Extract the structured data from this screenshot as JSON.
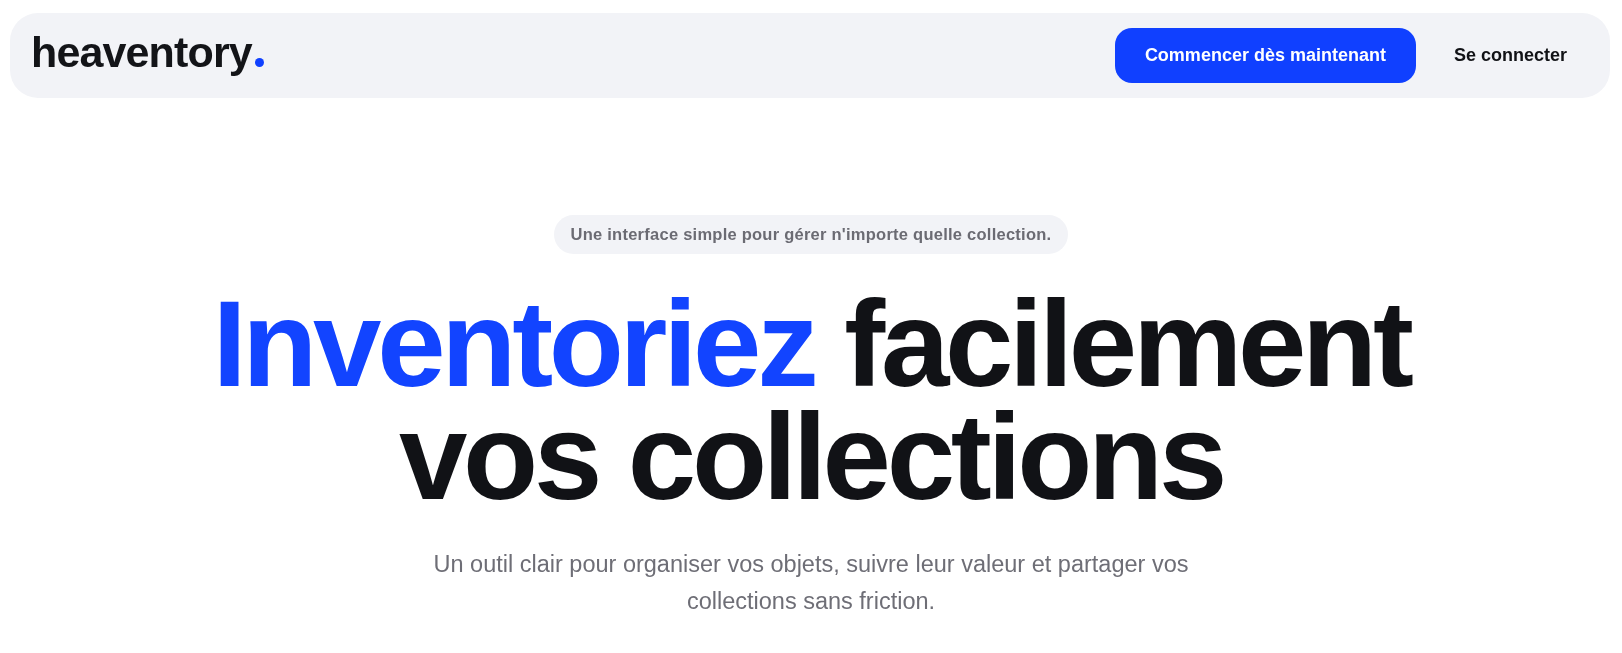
{
  "header": {
    "logo": {
      "name": "heaventory"
    },
    "buttons": [
      {
        "label": "Commencer dès maintenant",
        "kind": "primary"
      },
      {
        "label": "Se connecter",
        "kind": "link"
      }
    ]
  },
  "hero": {
    "tagline": "Une interface simple pour gérer n'importe quelle collection.",
    "heading": {
      "highlight": "Inventoriez",
      "rest": "facilement vos collections"
    },
    "subtitle": "Un outil clair pour organiser vos objets, suivre leur valeur et partager vos collections sans friction."
  }
}
